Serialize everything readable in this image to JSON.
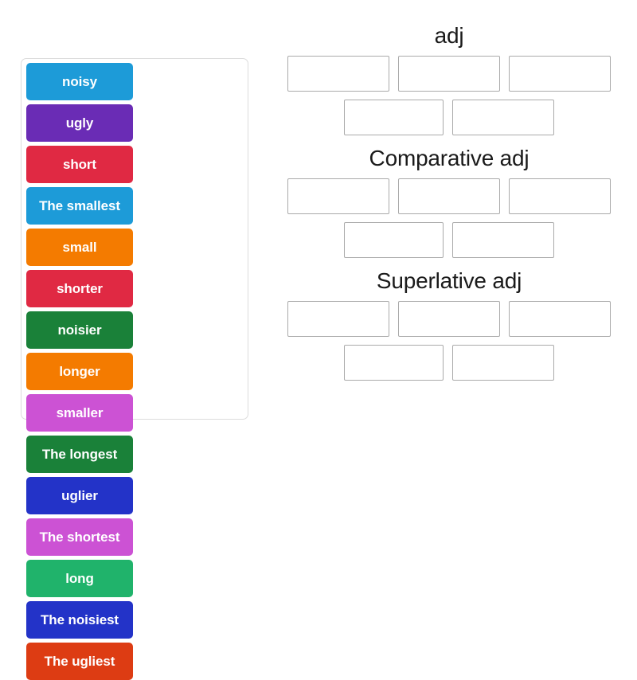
{
  "activity": {
    "type": "group-sort",
    "tile_panel": {
      "name": "word-tiles",
      "tiles": [
        {
          "label": "noisy",
          "color": "#1d9bd8"
        },
        {
          "label": "ugly",
          "color": "#6a2cb5"
        },
        {
          "label": "short",
          "color": "#e02943"
        },
        {
          "label": "The smallest",
          "color": "#1d9bd8"
        },
        {
          "label": "small",
          "color": "#f47b00"
        },
        {
          "label": "shorter",
          "color": "#e02943"
        },
        {
          "label": "noisier",
          "color": "#1a8139"
        },
        {
          "label": "longer",
          "color": "#f47b00"
        },
        {
          "label": "smaller",
          "color": "#cc52d4"
        },
        {
          "label": "The longest",
          "color": "#1a8139"
        },
        {
          "label": "uglier",
          "color": "#2333c8"
        },
        {
          "label": "The shortest",
          "color": "#cc52d4"
        },
        {
          "label": "long",
          "color": "#20b36b"
        },
        {
          "label": "The noisiest",
          "color": "#2333c8"
        },
        {
          "label": "The ugliest",
          "color": "#dd3c13"
        }
      ]
    },
    "categories": [
      {
        "title": "adj",
        "slots_top": [
          "",
          "",
          ""
        ],
        "slots_bottom": [
          "",
          ""
        ]
      },
      {
        "title": "Comparative adj",
        "slots_top": [
          "",
          "",
          ""
        ],
        "slots_bottom": [
          "",
          ""
        ]
      },
      {
        "title": "Superlative adj",
        "slots_top": [
          "",
          "",
          ""
        ],
        "slots_bottom": [
          "",
          ""
        ]
      }
    ]
  },
  "colors": {
    "panel_border": "#dcdcdc",
    "slot_border": "#aaaaaa",
    "title_text": "#1a1a1a",
    "tile_text": "#ffffff",
    "background": "#ffffff"
  }
}
